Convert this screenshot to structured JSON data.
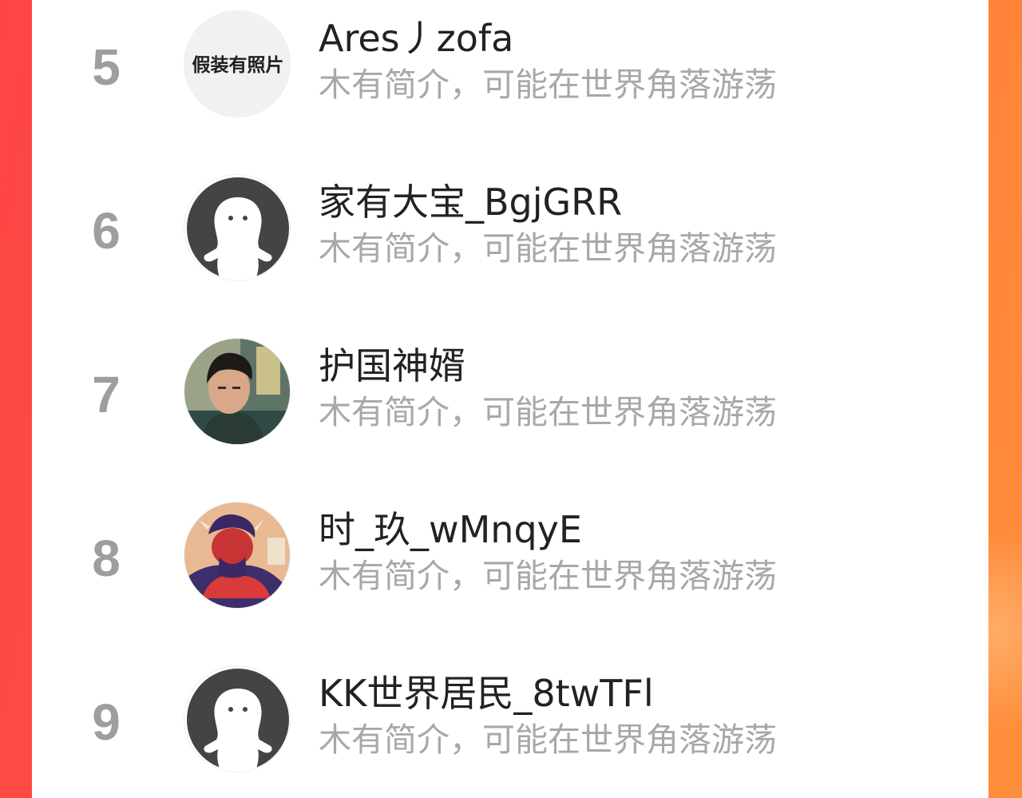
{
  "ranking": {
    "items": [
      {
        "rank": "5",
        "name": "Ares丿zofa",
        "bio": "木有简介，可能在世界角落游荡",
        "avatar": "placeholder-text-avatar",
        "avatar_text": "假装有照片"
      },
      {
        "rank": "6",
        "name": "家有大宝_BgjGRR",
        "bio": "木有简介，可能在世界角落游荡",
        "avatar": "default-ghost-avatar"
      },
      {
        "rank": "7",
        "name": "护国神婿",
        "bio": "木有简介，可能在世界角落游荡",
        "avatar": "photo-avatar"
      },
      {
        "rank": "8",
        "name": "时_玖_wMnqyE",
        "bio": "木有简介，可能在世界角落游荡",
        "avatar": "illustration-avatar"
      },
      {
        "rank": "9",
        "name": "KK世界居民_8twTFl",
        "bio": "木有简介，可能在世界角落游荡",
        "avatar": "default-ghost-avatar"
      }
    ]
  },
  "colors": {
    "rank": "#9e9e9e",
    "name": "#222222",
    "bio": "#a8a8a8",
    "panel": "#ffffff",
    "background_start": "#fd4545",
    "background_end": "#ff8f3b"
  }
}
